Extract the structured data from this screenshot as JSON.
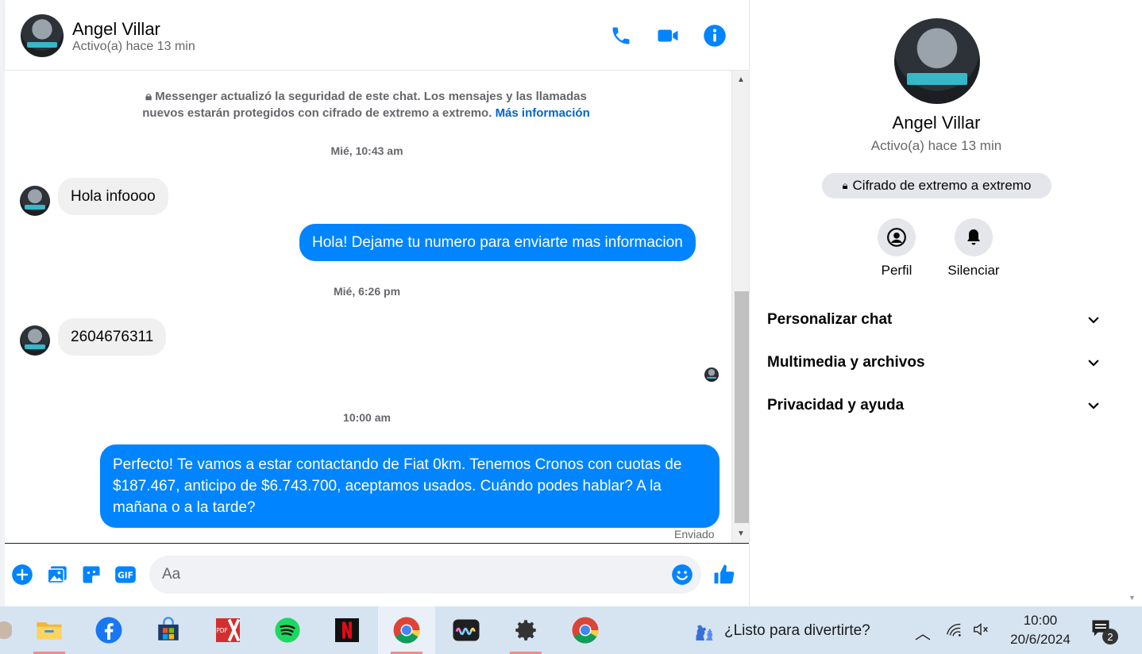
{
  "header": {
    "name": "Angel Villar",
    "status": "Activo(a) hace 13 min"
  },
  "security_notice": {
    "text": "Messenger actualizó la seguridad de este chat. Los mensajes y las llamadas nuevos estarán protegidos con cifrado de extremo a extremo.",
    "link": "Más información"
  },
  "messages": [
    {
      "type": "timestamp",
      "text": "Mié, 10:43 am"
    },
    {
      "type": "incoming",
      "text": "Hola infoooo"
    },
    {
      "type": "outgoing",
      "text": "Hola! Dejame tu numero para enviarte mas informacion"
    },
    {
      "type": "timestamp",
      "text": "Mié, 6:26 pm"
    },
    {
      "type": "incoming",
      "text": "2604676311"
    },
    {
      "type": "timestamp",
      "text": "10:00 am"
    },
    {
      "type": "outgoing",
      "text": "Perfecto! Te vamos a estar contactando de Fiat 0km. Tenemos Cronos con cuotas de $187.467, anticipo de $6.743.700, aceptamos usados. Cuándo podes hablar? A la mañana o a la tarde?"
    }
  ],
  "sent_status": "Enviado",
  "composer": {
    "placeholder": "Aa"
  },
  "info_panel": {
    "name": "Angel Villar",
    "status": "Activo(a) hace 13 min",
    "e2e_label": "Cifrado de extremo a extremo",
    "actions": [
      {
        "label": "Perfil",
        "icon": "profile-icon"
      },
      {
        "label": "Silenciar",
        "icon": "bell-icon"
      }
    ],
    "sections": [
      {
        "label": "Personalizar chat"
      },
      {
        "label": "Multimedia y archivos"
      },
      {
        "label": "Privacidad y ayuda"
      }
    ]
  },
  "taskbar": {
    "apps": [
      "file-explorer",
      "facebook",
      "microsoft-store",
      "pdf-editor",
      "spotify",
      "netflix",
      "chrome",
      "audio-app",
      "settings",
      "chrome"
    ],
    "search_text": "¿Listo para divertirte?",
    "time": "10:00",
    "date": "20/6/2024",
    "notification_count": "2"
  },
  "colors": {
    "messenger_blue": "#0084ff",
    "incoming_bubble": "#f0f0f0",
    "link": "#0064d1",
    "taskbar": "#d6e4f2"
  }
}
